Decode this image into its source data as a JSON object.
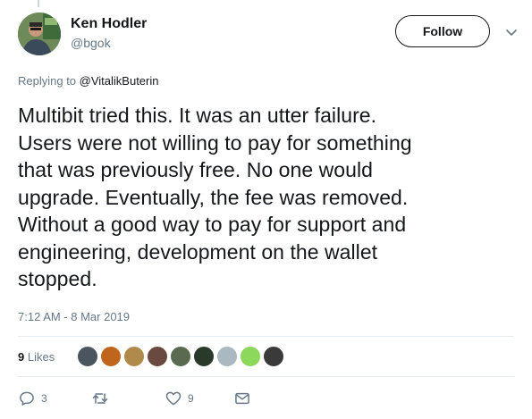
{
  "author": {
    "name": "Ken Hodler",
    "handle": "@bgok",
    "avatar_icon": "profile-photo"
  },
  "follow_button": {
    "label": "Follow"
  },
  "reply_context": {
    "prefix": "Replying to ",
    "mention": "@VitalikButerin"
  },
  "tweet": {
    "lines": [
      "Multibit tried this. It was an utter failure.",
      "Users were not willing to pay for something",
      "that was previously free. No one would",
      "upgrade. Eventually, the fee was removed.",
      "Without a good way to pay for support and",
      "engineering, development on the wallet",
      "stopped."
    ],
    "timestamp": "7:12 AM - 8 Mar 2019"
  },
  "stats": {
    "likes_count": "9",
    "likes_label": "Likes",
    "likers": [
      {
        "icon": "liker-avatar-1",
        "color": "#4a5560"
      },
      {
        "icon": "liker-avatar-2",
        "color": "#c0651e"
      },
      {
        "icon": "liker-avatar-3",
        "color": "#b08a4a"
      },
      {
        "icon": "liker-avatar-4",
        "color": "#6a4a40"
      },
      {
        "icon": "liker-avatar-5",
        "color": "#5a6a50"
      },
      {
        "icon": "liker-avatar-6",
        "color": "#2a3a2a"
      },
      {
        "icon": "liker-avatar-7",
        "color": "#aab8c2"
      },
      {
        "icon": "liker-avatar-8",
        "color": "#8bd85a"
      },
      {
        "icon": "liker-avatar-9",
        "color": "#3a3a3a"
      }
    ]
  },
  "actions": {
    "reply_count": "3",
    "retweet_count": "",
    "like_count": "9"
  },
  "colors": {
    "primary_text": "#14171a",
    "secondary_text": "#657786",
    "divider": "#e6ecf0"
  }
}
